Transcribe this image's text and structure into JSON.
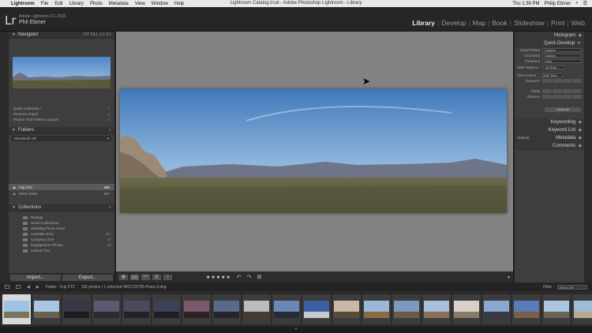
{
  "menubar": {
    "app": "Lightroom",
    "items": [
      "File",
      "Edit",
      "Library",
      "Photo",
      "Metadata",
      "View",
      "Window",
      "Help"
    ],
    "window_title": "Lightroom Catalog.lrcat - Adobe Photoshop Lightroom - Library",
    "clock": "Thu 1:39 PM",
    "user": "Philip Ebiner"
  },
  "identity": {
    "logo": "Lr",
    "line1": "Adobe Lightroom CC 2015",
    "line2": "Phil Ebiner"
  },
  "modules": [
    "Library",
    "Develop",
    "Map",
    "Book",
    "Slideshow",
    "Print",
    "Web"
  ],
  "active_module": "Library",
  "left": {
    "navigator": {
      "title": "Navigator",
      "zoom": "FIT  FILL  1:1  3:1"
    },
    "catalog_rows": [
      {
        "label": "Quick Collection +",
        "count": "0"
      },
      {
        "label": "Previous Import",
        "count": "3"
      },
      {
        "label": "Photos That Failed to Export",
        "count": "1"
      }
    ],
    "folders": {
      "title": "Folders",
      "drive": "Macintosh HD",
      "volumes": [
        {
          "label": "Fuji XT2",
          "count": "596",
          "selected": true
        },
        {
          "label": "Nikon D800",
          "count": "287",
          "selected": false
        }
      ]
    },
    "collections": {
      "title": "Collections",
      "items": [
        {
          "label": "Ratings",
          "count": ""
        },
        {
          "label": "Smart Collections",
          "count": ""
        },
        {
          "label": "Wedding Photo Class",
          "count": ""
        },
        {
          "label": "Australia 2016",
          "count": "457"
        },
        {
          "label": "Camping 2016",
          "count": "67"
        },
        {
          "label": "Engagement Photos",
          "count": "62"
        },
        {
          "label": "Joshua Tree",
          "count": ""
        }
      ]
    },
    "import_label": "Import...",
    "export_label": "Export..."
  },
  "toolbar": {
    "stars": "★★★★★"
  },
  "right": {
    "histogram": "Histogram",
    "quick_develop": "Quick Develop",
    "saved_preset_label": "Saved Preset",
    "saved_preset_value": "Custom",
    "crop_ratio_label": "Crop Ratio",
    "crop_ratio_value": "Custom",
    "treatment_label": "Treatment",
    "treatment_value": "Color",
    "white_balance_label": "White Balance",
    "white_balance_value": "As Shot",
    "tone_control_label": "Tone Control",
    "tone_control_value": "Auto Tone",
    "exposure_label": "Exposure",
    "clarity_label": "Clarity",
    "vibrance_label": "Vibrance",
    "reset_label": "Reset All",
    "keywording": "Keywording",
    "keyword_list": "Keyword List",
    "metadata": "Metadata",
    "metadata_preset": "Default",
    "comments": "Comments"
  },
  "filmstrip": {
    "folder": "Folder : Fuji XT2",
    "info": "165 photos / 1 selected /WCC25765-Pano-3.dng",
    "filter_label": "Filter :",
    "filter_value": "Filters Off",
    "thumbs": [
      {
        "sky": "#9ec3e6",
        "ground": "#7a7460"
      },
      {
        "sky": "#a9c7e4",
        "ground": "#6a6250"
      },
      {
        "sky": "#3a3644",
        "ground": "#1c1c22"
      },
      {
        "sky": "#5a5a70",
        "ground": "#2a2a30"
      },
      {
        "sky": "#4a4a5c",
        "ground": "#222226"
      },
      {
        "sky": "#3c4258",
        "ground": "#1e1e24"
      },
      {
        "sky": "#7a5a6a",
        "ground": "#2a2224"
      },
      {
        "sky": "#5a6a8a",
        "ground": "#24242c"
      },
      {
        "sky": "#bcbcbc",
        "ground": "#4a3a30"
      },
      {
        "sky": "#6a88b6",
        "ground": "#2a2a34"
      },
      {
        "sky": "#3a5fa0",
        "ground": "#c8c8d0"
      },
      {
        "sky": "#c8b8a8",
        "ground": "#5a4a3a"
      },
      {
        "sky": "#9ab8d8",
        "ground": "#8a6a40"
      },
      {
        "sky": "#7a9ac0",
        "ground": "#6a5a48"
      },
      {
        "sky": "#a8c0da",
        "ground": "#8a7058"
      },
      {
        "sky": "#d8d0c8",
        "ground": "#8a7a68"
      },
      {
        "sky": "#8aa8d0",
        "ground": "#3a3a46"
      },
      {
        "sky": "#5a7ab8",
        "ground": "#7a6048"
      },
      {
        "sky": "#aac6e2",
        "ground": "#6a6252"
      },
      {
        "sky": "#9cbcd8",
        "ground": "#b8a890"
      }
    ]
  }
}
